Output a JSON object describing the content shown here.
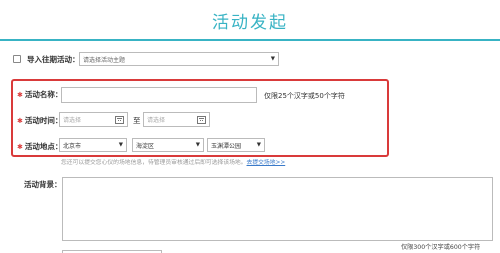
{
  "title": "活动发起",
  "colors": {
    "accent": "#38b3c4",
    "required": "#d93a3a",
    "link": "#3a7ac9"
  },
  "import": {
    "label": "导入往期活动：",
    "placeholder": "请选择活动主题"
  },
  "name": {
    "label": "活动名称：",
    "value": "",
    "limit": "仅限25个汉字或50个字符"
  },
  "time": {
    "label": "活动时间：",
    "start_placeholder": "请选择",
    "separator": "至",
    "end_placeholder": "请选择"
  },
  "place": {
    "label": "活动地点：",
    "city": "北京市",
    "district": "海淀区",
    "venue": "玉渊潭公园"
  },
  "hint": {
    "text": "您还可以提交您心仪的场地信息，待管理员审核通过后即可选择该场地。",
    "link": "去提交场地>>"
  },
  "background": {
    "label": "活动背景：",
    "limit": "仅限300个汉字或600个字符"
  },
  "icons": {
    "required": "required-star-icon",
    "calendar": "calendar-icon",
    "dropdown": "caret-down-icon",
    "checkbox": "checkbox-icon"
  }
}
